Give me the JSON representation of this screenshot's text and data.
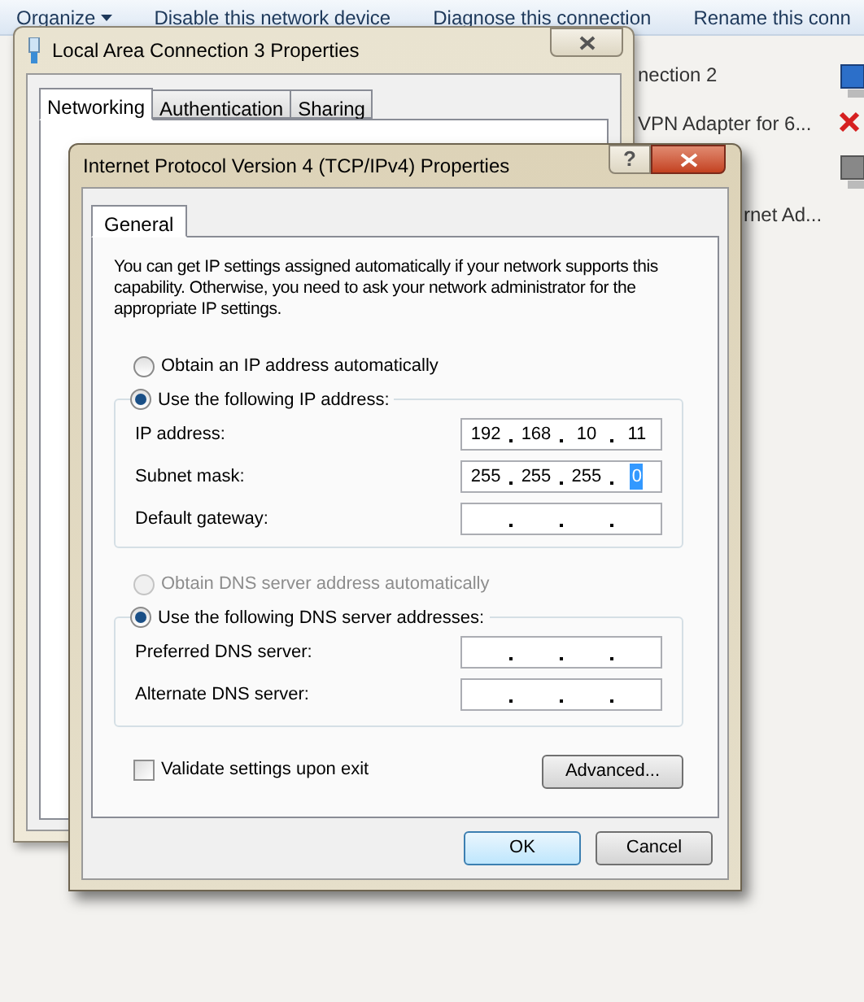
{
  "explorer": {
    "toolbar": [
      {
        "label": "Organize",
        "kind": "menu"
      },
      {
        "label": "Disable this network device",
        "kind": "action"
      },
      {
        "label": "Diagnose this connection",
        "kind": "action"
      },
      {
        "label": "Rename this conn",
        "kind": "action"
      }
    ],
    "adapters": [
      {
        "label": "nection 2",
        "kind": "network"
      },
      {
        "label": "VPN Adapter for 6...",
        "kind": "disconnected"
      },
      {
        "label": "rnet Ad...",
        "kind": "network-grey"
      }
    ]
  },
  "lan_dialog": {
    "title": "Local Area Connection 3 Properties",
    "tabs": [
      {
        "label": "Networking",
        "selected": true
      },
      {
        "label": "Authentication",
        "selected": false
      },
      {
        "label": "Sharing",
        "selected": false
      }
    ]
  },
  "ipv4_dialog": {
    "title": "Internet Protocol Version 4 (TCP/IPv4) Properties",
    "help": "?",
    "tabs": [
      {
        "label": "General",
        "selected": true
      }
    ],
    "intro": "You can get IP settings assigned automatically if your network supports this capability. Otherwise, you need to ask your network administrator for the appropriate IP settings.",
    "ip_options": [
      {
        "label": "Obtain an IP address automatically",
        "selected": false,
        "disabled": false
      },
      {
        "label": "Use the following IP address:",
        "selected": true,
        "disabled": false
      }
    ],
    "ip_fields": [
      {
        "label": "IP address:",
        "octets": [
          {
            "value": "192",
            "selected": false
          },
          {
            "value": "168",
            "selected": false
          },
          {
            "value": "10",
            "selected": false
          },
          {
            "value": "11",
            "selected": false
          }
        ]
      },
      {
        "label": "Subnet mask:",
        "octets": [
          {
            "value": "255",
            "selected": false
          },
          {
            "value": "255",
            "selected": false
          },
          {
            "value": "255",
            "selected": false
          },
          {
            "value": "0",
            "selected": true
          }
        ]
      },
      {
        "label": "Default gateway:"
      }
    ],
    "dns_options": [
      {
        "label": "Obtain DNS server address automatically",
        "selected": false,
        "disabled": true
      },
      {
        "label": "Use the following DNS server addresses:",
        "selected": true,
        "disabled": false
      }
    ],
    "dns_fields": [
      {
        "label": "Preferred DNS server:"
      },
      {
        "label": "Alternate DNS server:"
      }
    ],
    "validate": {
      "label": "Validate settings upon exit",
      "checked": false
    },
    "advanced_button": {
      "label": "Advanced..."
    },
    "buttons": [
      {
        "label": "OK",
        "default": true
      },
      {
        "label": "Cancel",
        "default": false
      }
    ]
  }
}
